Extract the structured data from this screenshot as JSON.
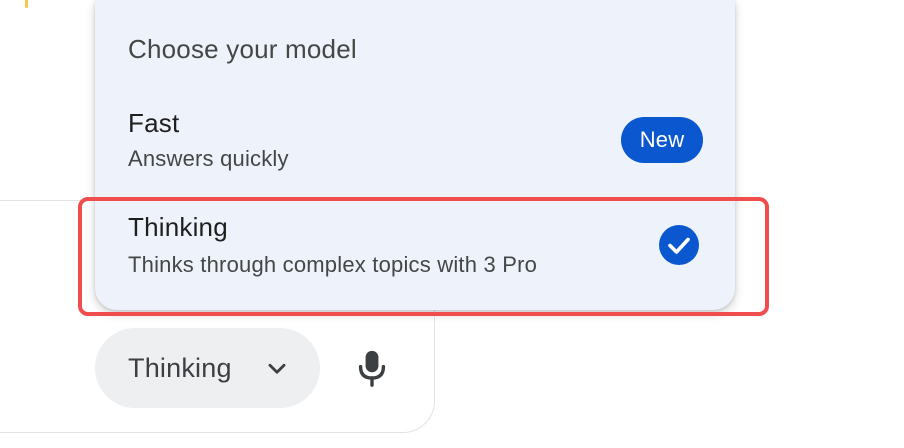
{
  "menu": {
    "heading": "Choose your model",
    "options": [
      {
        "title": "Fast",
        "description": "Answers quickly",
        "badge": "New",
        "selected": false
      },
      {
        "title": "Thinking",
        "description": "Thinks through complex topics with 3 Pro",
        "selected": true
      }
    ]
  },
  "composer": {
    "model_selector_label": "Thinking",
    "icons": [
      "chevron-down-icon",
      "microphone-icon"
    ]
  },
  "colors": {
    "accent": "#0b57d0",
    "menu_background": "#eef2fa",
    "highlight": "#f04d4d",
    "pill_background": "#eeeff1"
  }
}
